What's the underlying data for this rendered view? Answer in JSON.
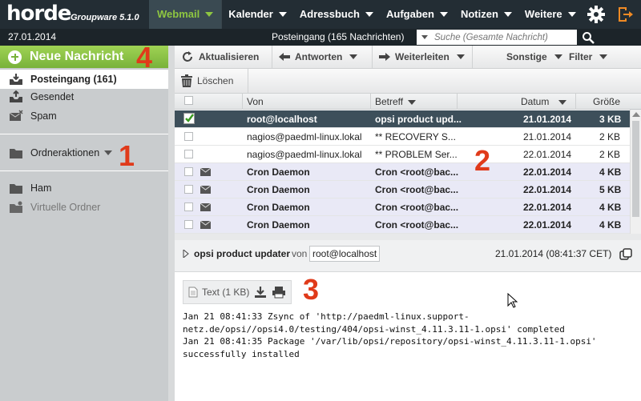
{
  "app": {
    "logo": "horde",
    "version": "Groupware 5.1.0"
  },
  "nav": {
    "items": [
      {
        "label": "Webmail"
      },
      {
        "label": "Kalender"
      },
      {
        "label": "Adressbuch"
      },
      {
        "label": "Aufgaben"
      },
      {
        "label": "Notizen"
      },
      {
        "label": "Weitere"
      }
    ]
  },
  "infobar": {
    "date": "27.01.2014",
    "mailbox_title": "Posteingang (165 Nachrichten)",
    "search_placeholder": "Suche (Gesamte Nachricht)"
  },
  "sidebar": {
    "new_message": "Neue Nachricht",
    "folders": [
      {
        "label": "Posteingang (161)"
      },
      {
        "label": "Gesendet"
      },
      {
        "label": "Spam"
      }
    ],
    "folder_actions": "Ordneraktionen",
    "folders2": [
      {
        "label": "Ham"
      },
      {
        "label": "Virtuelle Ordner"
      }
    ]
  },
  "toolbar": {
    "refresh": "Aktualisieren",
    "reply": "Antworten",
    "forward": "Weiterleiten",
    "other": "Sonstige",
    "filter": "Filter",
    "delete": "Löschen"
  },
  "list": {
    "headers": {
      "from": "Von",
      "subject": "Betreff",
      "date": "Datum",
      "size": "Größe"
    },
    "rows": [
      {
        "from": "root@localhost",
        "subject": "opsi product upd...",
        "date": "21.01.2014",
        "size": "3 KB"
      },
      {
        "from": "nagios@paedml-linux.lokal",
        "subject": "** RECOVERY S...",
        "date": "21.01.2014",
        "size": "2 KB"
      },
      {
        "from": "nagios@paedml-linux.lokal",
        "subject": "** PROBLEM Ser...",
        "date": "22.01.2014",
        "size": "2 KB"
      },
      {
        "from": "Cron Daemon",
        "subject": "Cron <root@bac...",
        "date": "22.01.2014",
        "size": "4 KB"
      },
      {
        "from": "Cron Daemon",
        "subject": "Cron <root@bac...",
        "date": "22.01.2014",
        "size": "5 KB"
      },
      {
        "from": "Cron Daemon",
        "subject": "Cron <root@bac...",
        "date": "22.01.2014",
        "size": "4 KB"
      },
      {
        "from": "Cron Daemon",
        "subject": "Cron <root@bac...",
        "date": "22.01.2014",
        "size": "4 KB"
      }
    ]
  },
  "preview": {
    "subject": "opsi product updater",
    "von": "von",
    "from": "root@localhost",
    "date": "21.01.2014 (08:41:37 CET)",
    "attachment": "Text (1 KB)",
    "body_lines": [
      "Jan 21 08:41:33 Zsync of 'http://paedml-linux.support-",
      "netz.de/opsi//opsi4.0/testing/404/opsi-winst_4.11.3.11-1.opsi' completed",
      "Jan 21 08:41:35 Package '/var/lib/opsi/repository/opsi-winst_4.11.3.11-1.opsi'",
      "successfully installed"
    ]
  },
  "callouts": {
    "c1": "1",
    "c2": "2",
    "c3": "3",
    "c4": "4"
  },
  "colors": {
    "accent_green": "#8ec641",
    "callout_red": "#e03a1a",
    "selected_row": "#3d4f5a",
    "unread_row": "#e9e9f6"
  }
}
